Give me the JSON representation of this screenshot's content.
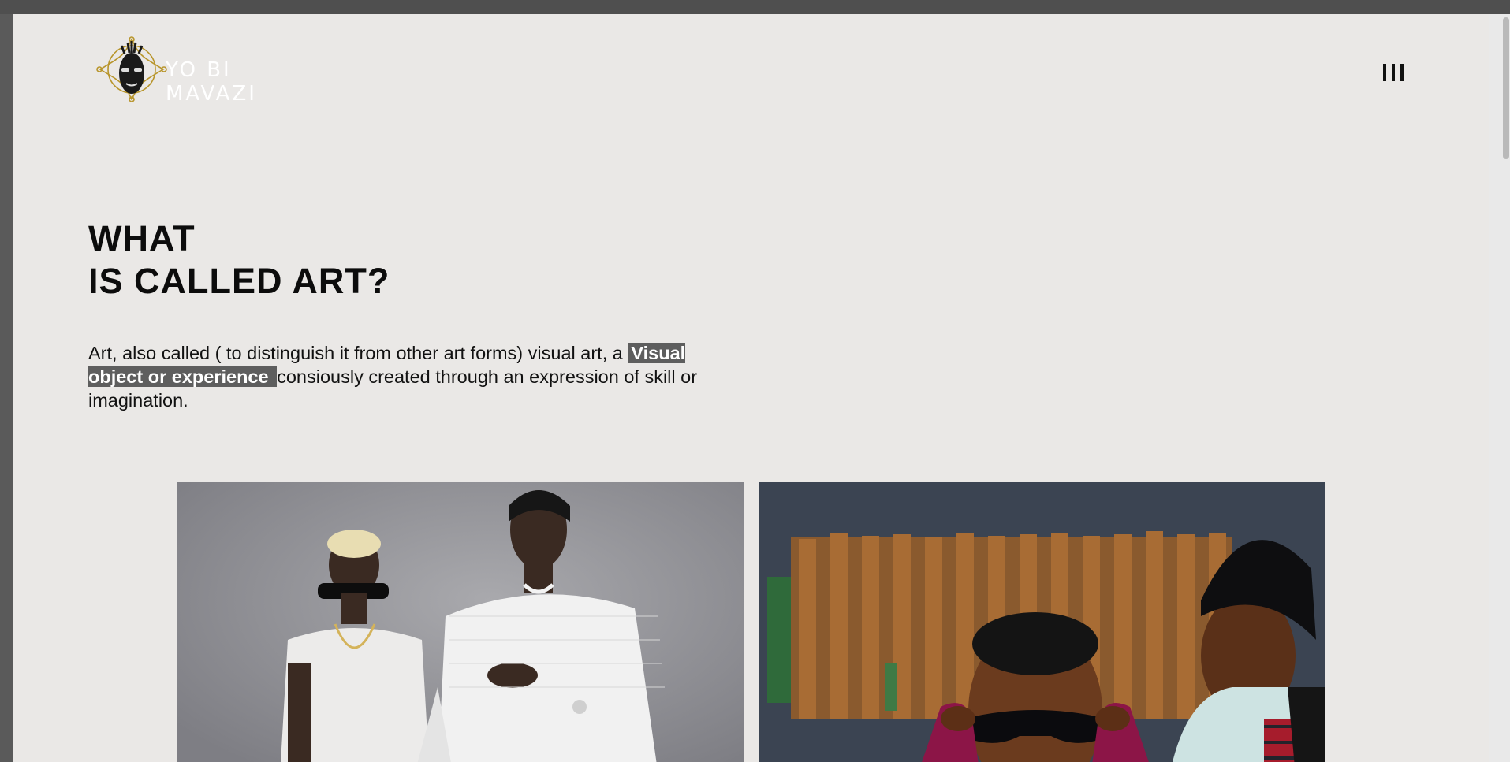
{
  "logo": {
    "line1": "YO BI",
    "line2": "MAVAZI",
    "accent_color": "#b8952b"
  },
  "menu": {
    "icon": "hamburger-menu-icon"
  },
  "hero": {
    "heading_line1": "WHAT",
    "heading_line2": "IS CALLED ART?",
    "text_before": "Art, also called ( to distinguish it from other art forms) visual art, a ",
    "highlight": "Visual object or experience ",
    "text_after": " consiously created through an expression of skill or imagination.",
    "highlight_bg": "#5e5e5e"
  },
  "gallery": {
    "photos": [
      {
        "subject": "two men in white mesh shirts and sunglasses on grey background"
      },
      {
        "subject": "man in sunglasses and magenta jacket with man in black beanie"
      }
    ]
  },
  "colors": {
    "page_bg": "#eae8e6",
    "text": "#0c0c0c"
  }
}
